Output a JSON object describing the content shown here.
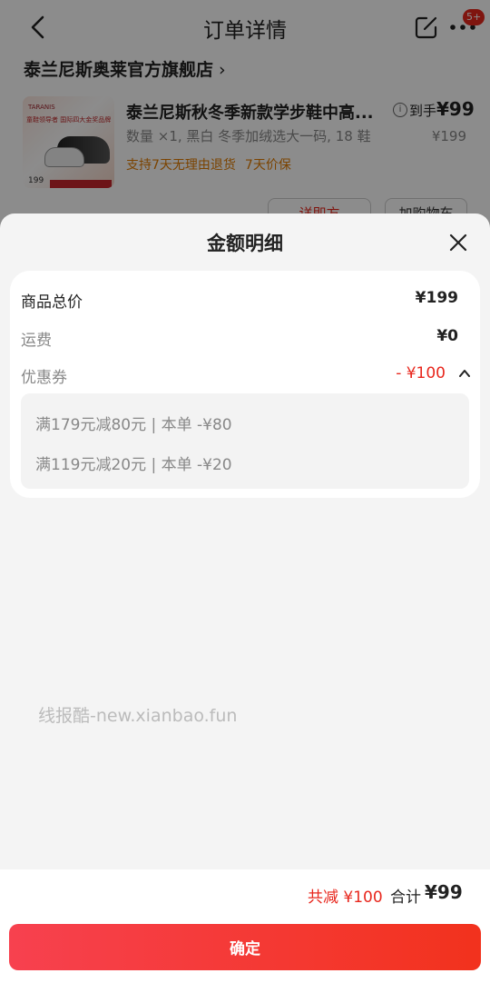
{
  "nav": {
    "title": "订单详情",
    "badge": "5+"
  },
  "store": {
    "name": "泰兰尼斯奥莱官方旗舰店",
    "chevron": "›"
  },
  "product": {
    "title": "泰兰尼斯秋冬季新款学步鞋中高...",
    "spec": "数量 ×1, 黑白 冬季加绒选大一码, 18 鞋",
    "tags": [
      "支持7天无理由退货",
      "7天价保"
    ],
    "arrive_label": "到手",
    "arrive_price": "¥99",
    "original_price": "¥199",
    "thumb_brand": "TARANIS",
    "thumb_text": "童鞋领导者 国际四大金奖品牌",
    "thumb_price": "199"
  },
  "order_buttons": [
    "详即方",
    "加购物车"
  ],
  "sheet": {
    "title": "金额明细",
    "rows": {
      "goods_total": {
        "label": "商品总价",
        "value": "¥199"
      },
      "shipping": {
        "label": "运费",
        "value": "¥0"
      },
      "coupon": {
        "label": "优惠券",
        "value": "- ¥100"
      }
    },
    "coupons": [
      "满179元减80元 | 本单 -¥80",
      "满119元减20元 | 本单 -¥20"
    ],
    "watermark": "线报酷-new.xianbao.fun"
  },
  "footer": {
    "reduction": "共减 ¥100",
    "total_label": "合计",
    "total_value": "¥99",
    "confirm_label": "确定"
  },
  "colors": {
    "accent": "#e8271d",
    "button_start": "#f7414f",
    "button_end": "#f2321d"
  }
}
